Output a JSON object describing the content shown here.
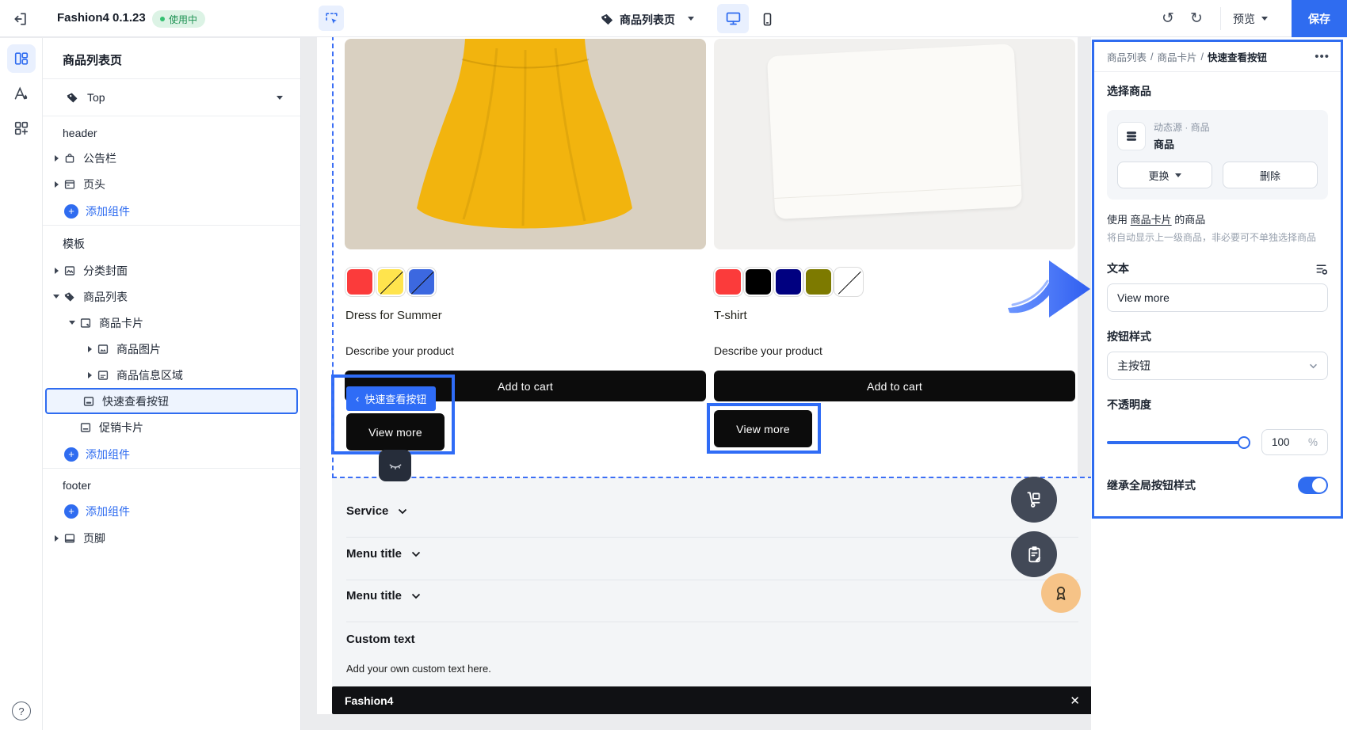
{
  "colors": {
    "accent_blue": "#2f6cf0",
    "selection_blue": "#2f6cf6",
    "badge_green_bg": "#dcf3e5",
    "badge_green_text": "#1f9254",
    "canvas_bg": "#ebecee",
    "preview_footer_bg": "#f3f5f7",
    "button_black": "#0c0c0c",
    "float_circle_dark": "#424957",
    "float_circle_orange": "#f6c387",
    "image1_bg": "#d9d0c1",
    "image2_bg": "#f1f0ee",
    "dress_yellow": "#f2b40e"
  },
  "topbar": {
    "title": "Fashion4 0.1.23",
    "status_badge": "使用中",
    "page_selector": "商品列表页",
    "preview_label": "预览",
    "save_label": "保存"
  },
  "sidebar": {
    "panel_title": "商品列表页",
    "top_selector": "Top",
    "group_header": "header",
    "group_template": "模板",
    "group_footer": "footer",
    "add_component": "添加组件",
    "items": {
      "announcement": "公告栏",
      "page_header": "页头",
      "category_cover": "分类封面",
      "product_list": "商品列表",
      "product_card": "商品卡片",
      "product_image": "商品图片",
      "product_info": "商品信息区域",
      "quick_view_button": "快速查看按钮",
      "promo_card": "促销卡片",
      "page_footer": "页脚"
    }
  },
  "canvas": {
    "selection_label": "快速查看按钮",
    "products": [
      {
        "name": "Dress for Summer",
        "description": "Describe your product",
        "add_to_cart": "Add to cart",
        "view_more": "View more",
        "swatches": [
          {
            "color": "#fb3b3b",
            "sold_out": false
          },
          {
            "color": "#ffe44d",
            "sold_out": true
          },
          {
            "color": "#3c68e0",
            "sold_out": true
          }
        ]
      },
      {
        "name": "T-shirt",
        "description": "Describe your product",
        "add_to_cart": "Add to cart",
        "view_more": "View more",
        "swatches": [
          {
            "color": "#fb3b3b",
            "sold_out": false
          },
          {
            "color": "#000000",
            "sold_out": false
          },
          {
            "color": "#000080",
            "sold_out": false
          },
          {
            "color": "#7d7a00",
            "sold_out": false
          },
          {
            "color": "#ffffff",
            "sold_out": true
          }
        ]
      }
    ],
    "footer": {
      "menus": [
        "Service",
        "Menu title",
        "Menu title"
      ],
      "custom_title": "Custom text",
      "custom_text": "Add your own custom text here.",
      "brand_bar": "Fashion4"
    }
  },
  "inspector": {
    "breadcrumb": {
      "parts": [
        "商品列表",
        "商品卡片"
      ],
      "current": "快速查看按钮",
      "separator": "/"
    },
    "select_product_label": "选择商品",
    "source_type": "动态源 · 商品",
    "source_name": "商品",
    "replace_label": "更换",
    "delete_label": "删除",
    "usage_prefix": "使用 ",
    "usage_link": "商品卡片",
    "usage_suffix": " 的商品",
    "usage_hint": "将自动显示上一级商品，非必要可不单独选择商品",
    "text_label": "文本",
    "text_value": "View more",
    "button_style_label": "按钮样式",
    "button_style_value": "主按钮",
    "opacity_label": "不透明度",
    "opacity_value": "100",
    "opacity_unit": "%",
    "inherit_label": "继承全局按钮样式"
  }
}
